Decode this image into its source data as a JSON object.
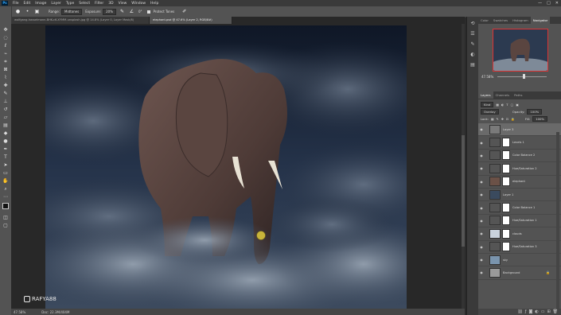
{
  "menu": {
    "items": [
      "File",
      "Edit",
      "Image",
      "Layer",
      "Type",
      "Select",
      "Filter",
      "3D",
      "View",
      "Window",
      "Help"
    ],
    "logo": "Ps"
  },
  "window_controls": {
    "minimize": "—",
    "maximize": "□",
    "close": "✕"
  },
  "options_bar": {
    "range_label": "Range:",
    "range_value": "Midtones",
    "exposure_label": "Exposure:",
    "exposure_value": "20%",
    "angle_value": "0°",
    "protect_tones_label": "Protect Tones"
  },
  "tabs": [
    {
      "label": "wolfgang-hasselmann-BHK-c6-XYMM-unsplash.jpg @ 14.8% (Layer 0, Layer Mask/8)",
      "active": false
    },
    {
      "label": "elephant.psd @ 47.6% (Layer 2, RGB/8#)",
      "active": true
    }
  ],
  "status_bar": {
    "zoom": "47.58%",
    "doc": "Doc: 22.3M/404M"
  },
  "panel": {
    "top_tabs": [
      "Color",
      "Swatches",
      "Histogram",
      "Navigator"
    ],
    "active_top_tab": "Navigator",
    "nav_zoom": "47.58%",
    "layer_tabs": [
      "Layers",
      "Channels",
      "Paths"
    ],
    "active_layer_tab": "Layers",
    "kind_label": "Kind",
    "blend_mode": "Overlay",
    "opacity_label": "Opacity:",
    "opacity_value": "100%",
    "lock_label": "Lock:",
    "fill_label": "Fill:",
    "fill_value": "100%"
  },
  "layers": [
    {
      "name": "Layer 3",
      "selected": true,
      "mask": false,
      "thumb": "#7a7a7a"
    },
    {
      "name": "Levels 1",
      "selected": false,
      "mask": true,
      "thumb": "#555"
    },
    {
      "name": "Color Balance 2",
      "selected": false,
      "mask": true,
      "thumb": "#555"
    },
    {
      "name": "Hue/Saturation 2",
      "selected": false,
      "mask": true,
      "thumb": "#555"
    },
    {
      "name": "elephant",
      "selected": false,
      "mask": true,
      "thumb": "#6b5147"
    },
    {
      "name": "Layer 1",
      "selected": false,
      "mask": false,
      "thumb": "#3a4a5e"
    },
    {
      "name": "Color Balance 1",
      "selected": false,
      "mask": true,
      "thumb": "#555"
    },
    {
      "name": "Hue/Saturation 1",
      "selected": false,
      "mask": true,
      "thumb": "#555"
    },
    {
      "name": "clouds",
      "selected": false,
      "mask": true,
      "thumb": "#c9d2dc"
    },
    {
      "name": "Hue/Saturation 3",
      "selected": false,
      "mask": true,
      "thumb": "#555"
    },
    {
      "name": "sky",
      "selected": false,
      "mask": false,
      "thumb": "#7a94ad"
    },
    {
      "name": "Background",
      "selected": false,
      "mask": false,
      "thumb": "#9a9a9a",
      "locked": true
    }
  ],
  "watermark": {
    "text": "RAFYA88"
  },
  "colors": {
    "menubar": "#3a3a3a",
    "panel": "#535353",
    "nav_frame": "#dd3333",
    "brush_cursor": "#c8b43a"
  },
  "icons": {
    "eye": "eye-icon",
    "lock": "lock-icon",
    "adjustment": "adjustment-icon"
  }
}
